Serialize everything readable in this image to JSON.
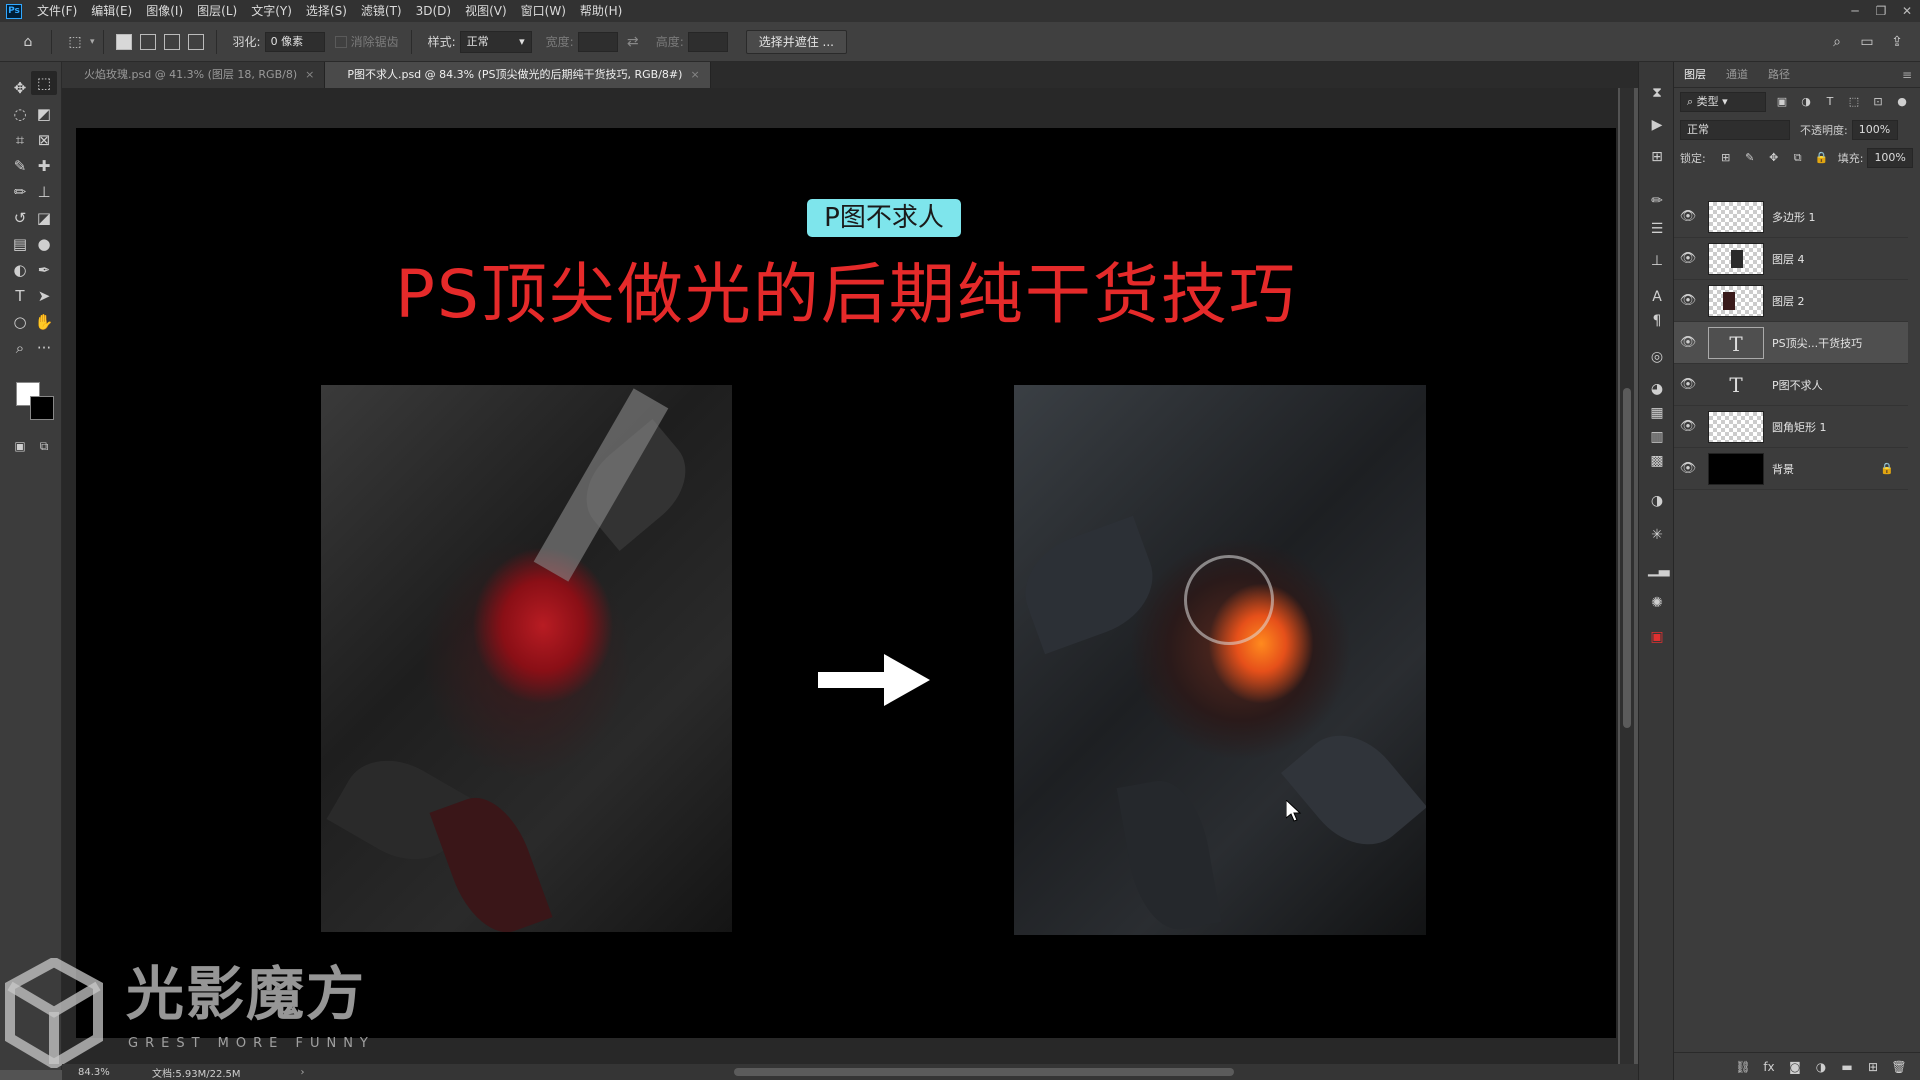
{
  "app": {
    "logo": "Ps"
  },
  "menu": [
    "文件(F)",
    "编辑(E)",
    "图像(I)",
    "图层(L)",
    "文字(Y)",
    "选择(S)",
    "滤镜(T)",
    "3D(D)",
    "视图(V)",
    "窗口(W)",
    "帮助(H)"
  ],
  "options": {
    "feather_label": "羽化:",
    "feather_value": "0 像素",
    "antialias_label": "消除锯齿",
    "style_label": "样式:",
    "style_value": "正常",
    "width_label": "宽度:",
    "height_label": "高度:",
    "mask_button": "选择并遮住 ..."
  },
  "tabs": [
    {
      "label": "火焰玫瑰.psd @ 41.3% (图层 18, RGB/8)",
      "active": false
    },
    {
      "label": "P图不求人.psd @ 84.3% (PS顶尖做光的后期纯干货技巧, RGB/8#)",
      "active": true
    }
  ],
  "canvas": {
    "badge": "P图不求人",
    "headline": "PS顶尖做光的后期纯干货技巧",
    "headline_color": "#e52a2a",
    "badge_color": "#7ee5ec"
  },
  "watermark": {
    "title": "光影魔方",
    "subtitle": "GREST MORE FUNNY"
  },
  "status": {
    "zoom": "84.3%",
    "doc": "文档:5.93M/22.5M"
  },
  "layers_panel": {
    "tabs": [
      "图层",
      "通道",
      "路径"
    ],
    "filter_kind": "类型",
    "blend_mode": "正常",
    "opacity_label": "不透明度:",
    "opacity_value": "100%",
    "lock_label": "锁定:",
    "fill_label": "填充:",
    "fill_value": "100%",
    "layers": [
      {
        "name": "多边形 1",
        "kind": "shape",
        "selected": false
      },
      {
        "name": "图层 4",
        "kind": "image",
        "selected": false
      },
      {
        "name": "图层 2",
        "kind": "image",
        "selected": false
      },
      {
        "name": "PS顶尖...干货技巧",
        "kind": "text",
        "selected": true
      },
      {
        "name": "P图不求人",
        "kind": "text",
        "selected": false
      },
      {
        "name": "圆角矩形 1",
        "kind": "shape",
        "selected": false
      },
      {
        "name": "背景",
        "kind": "background",
        "selected": false,
        "locked": true
      }
    ]
  }
}
